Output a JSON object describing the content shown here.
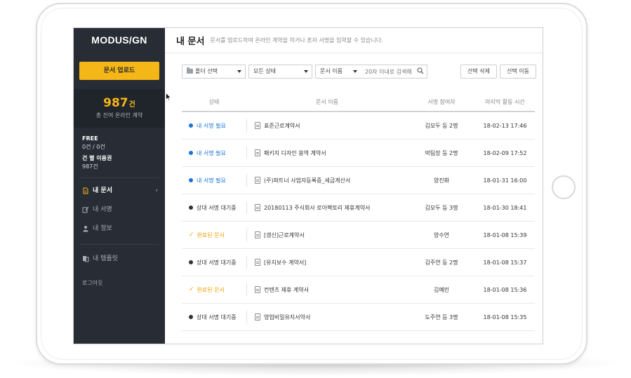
{
  "sidebar": {
    "logo": "MODUS/GN",
    "upload_button": "문서 업로드",
    "stat": {
      "count": "987",
      "unit": "건",
      "caption": "총 진여 온라인 계약"
    },
    "plan": {
      "plan_name": "FREE",
      "plan_usage": "0건 / 0건",
      "ticket_label": "건 별 이용권",
      "ticket_count": "987건"
    },
    "nav": [
      {
        "label": "내 문서",
        "icon": "document-icon",
        "active": true
      },
      {
        "label": "내 서명",
        "icon": "pen-icon",
        "active": false
      },
      {
        "label": "내 정보",
        "icon": "user-icon",
        "active": false
      },
      {
        "label": "내 템플릿",
        "icon": "template-icon",
        "active": false
      }
    ],
    "logout": "로그아웃"
  },
  "header": {
    "title": "내 문서",
    "description": "문서를 업로드하여 온라인 계약을 하거나 혼자 서명을 입력할 수 있습니다."
  },
  "toolbar": {
    "folder_select": "폴더 선택",
    "status_select": "모든 상태",
    "field_select": "문서 이름",
    "search_placeholder": "20자 이내로 검색해",
    "delete_button": "선택 삭제",
    "move_button": "선택 이동"
  },
  "table": {
    "columns": {
      "status": "상태",
      "name": "문서 이름",
      "signers": "서명 참여자",
      "last_activity": "마지막 활동 시간"
    },
    "rows": [
      {
        "status": "내 서명 필요",
        "kind": "need",
        "name": "표준근로계약서",
        "signers": "김모두 등 2명",
        "time": "18-02-13 17:46"
      },
      {
        "status": "내 서명 필요",
        "kind": "need",
        "name": "패키지 디자인 용역 계약서",
        "signers": "박팀장 등 2명",
        "time": "18-02-09 17:52"
      },
      {
        "status": "내 서명 필요",
        "kind": "need",
        "name": "(주)파트너 사업자등록증_세금계산서",
        "signers": "양진화",
        "time": "18-01-31 16:00"
      },
      {
        "status": "상대 서명 대기중",
        "kind": "wait",
        "name": "20180113 주식회사 로아팩토리 제휴계약서",
        "signers": "김모두 등 3명",
        "time": "18-01-30 18:41"
      },
      {
        "status": "완료된 문서",
        "kind": "done",
        "name": "[갱신]근로계약서",
        "signers": "양수연",
        "time": "18-01-08 15:39"
      },
      {
        "status": "상대 서명 대기중",
        "kind": "wait",
        "name": "[유지보수 계약서]",
        "signers": "김주연 등 2명",
        "time": "18-01-08 15:37"
      },
      {
        "status": "완료된 문서",
        "kind": "done",
        "name": "컨텐츠 제휴 계약서",
        "signers": "김예린",
        "time": "18-01-08 15:36"
      },
      {
        "status": "상대 서명 대기중",
        "kind": "wait",
        "name": "영업비밀유지서약서",
        "signers": "도주연 등 3명",
        "time": "18-01-08 15:35"
      }
    ]
  },
  "colors": {
    "sidebar_bg": "#272c35",
    "accent_yellow": "#f5b617",
    "need_blue": "#1a73d9",
    "wait_dark": "#333333",
    "done_orange": "#f5a000"
  }
}
